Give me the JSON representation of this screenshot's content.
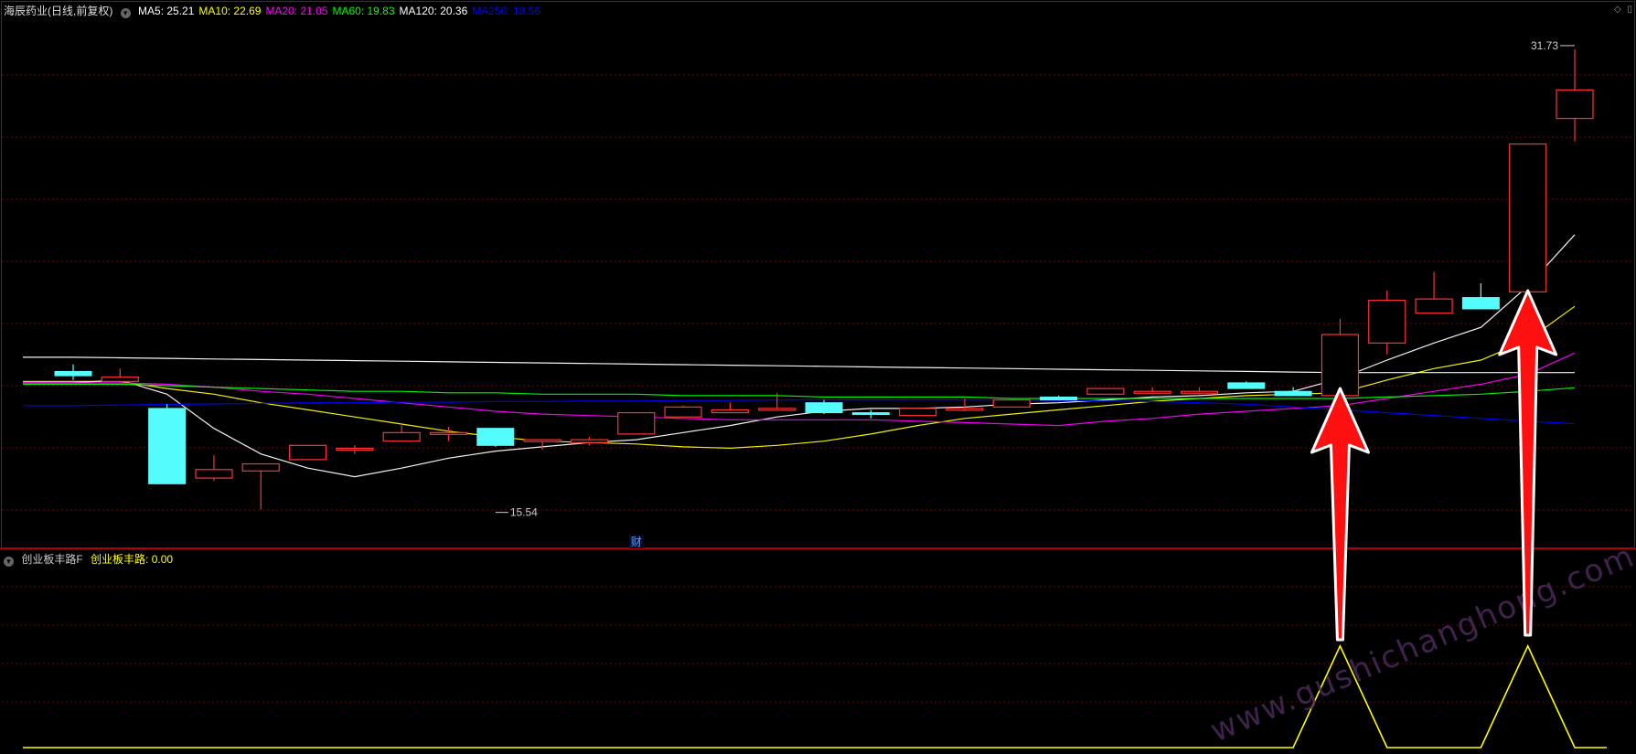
{
  "header": {
    "stock_title": "海辰药业(日线,前复权)",
    "ma_items": [
      {
        "label": "MA5: 25.21",
        "color": "#ffffff"
      },
      {
        "label": "MA10: 22.69",
        "color": "#ffff00"
      },
      {
        "label": "MA20: 21.05",
        "color": "#ff00ff"
      },
      {
        "label": "MA60: 19.83",
        "color": "#00ff00"
      },
      {
        "label": "MA120: 20.36",
        "color": "#ffffff"
      },
      {
        "label": "MA250: 18.56",
        "color": "#0000ff"
      }
    ]
  },
  "indicator": {
    "name": "创业板丰路F",
    "value_label": "创业板丰路: 0.00",
    "value_color": "#ffff00"
  },
  "badge": "财",
  "watermark": "www.gushichanghong.com",
  "chart_data": [
    {
      "type": "candlestick",
      "title": "海辰药业(日线,前复权)",
      "ylim": [
        14.5,
        32.5
      ],
      "annotations": [
        {
          "text": "15.54",
          "x": 9,
          "y": 15.54
        },
        {
          "text": "31.73",
          "x": 32,
          "y": 31.73
        }
      ],
      "up_color": "#ff3232",
      "down_color": "#54fcfc",
      "candles": [
        {
          "o": 20.4,
          "h": 20.65,
          "c": 20.25,
          "l": 20.1
        },
        {
          "o": 20.05,
          "h": 20.5,
          "c": 20.2,
          "l": 20.0
        },
        {
          "o": 19.1,
          "h": 19.25,
          "c": 16.45,
          "l": 16.45
        },
        {
          "o": 16.65,
          "h": 17.45,
          "c": 16.95,
          "l": 16.55
        },
        {
          "o": 16.9,
          "h": 17.0,
          "c": 17.15,
          "l": 15.54
        },
        {
          "o": 17.3,
          "h": 17.75,
          "c": 17.8,
          "l": 17.3
        },
        {
          "o": 17.65,
          "h": 17.8,
          "c": 17.7,
          "l": 17.5
        },
        {
          "o": 17.95,
          "h": 18.5,
          "c": 18.25,
          "l": 17.95
        },
        {
          "o": 18.2,
          "h": 18.45,
          "c": 18.25,
          "l": 17.95
        },
        {
          "o": 18.4,
          "h": 18.4,
          "c": 17.8,
          "l": 17.75
        },
        {
          "o": 17.95,
          "h": 18.0,
          "c": 18.0,
          "l": 17.65
        },
        {
          "o": 17.9,
          "h": 18.1,
          "c": 18.0,
          "l": 17.8
        },
        {
          "o": 18.2,
          "h": 18.9,
          "c": 18.95,
          "l": 18.2
        },
        {
          "o": 18.8,
          "h": 19.2,
          "c": 19.15,
          "l": 18.8
        },
        {
          "o": 18.95,
          "h": 19.3,
          "c": 19.05,
          "l": 18.95
        },
        {
          "o": 19.1,
          "h": 19.65,
          "c": 19.1,
          "l": 19.1
        },
        {
          "o": 19.3,
          "h": 19.4,
          "c": 18.95,
          "l": 18.9
        },
        {
          "o": 18.95,
          "h": 19.05,
          "c": 18.9,
          "l": 18.75
        },
        {
          "o": 18.85,
          "h": 18.95,
          "c": 19.1,
          "l": 18.85
        },
        {
          "o": 19.1,
          "h": 19.45,
          "c": 19.1,
          "l": 19.0
        },
        {
          "o": 19.15,
          "h": 19.4,
          "c": 19.4,
          "l": 19.15
        },
        {
          "o": 19.5,
          "h": 19.55,
          "c": 19.4,
          "l": 19.4
        },
        {
          "o": 19.6,
          "h": 19.7,
          "c": 19.8,
          "l": 19.6
        },
        {
          "o": 19.7,
          "h": 19.85,
          "c": 19.7,
          "l": 19.6
        },
        {
          "o": 19.7,
          "h": 19.85,
          "c": 19.7,
          "l": 19.6
        },
        {
          "o": 20.0,
          "h": 20.05,
          "c": 19.8,
          "l": 19.8
        },
        {
          "o": 19.7,
          "h": 19.85,
          "c": 19.55,
          "l": 19.55
        },
        {
          "o": 19.55,
          "h": 22.25,
          "c": 21.7,
          "l": 19.55
        },
        {
          "o": 21.4,
          "h": 23.25,
          "c": 22.9,
          "l": 21.0
        },
        {
          "o": 22.45,
          "h": 23.9,
          "c": 22.95,
          "l": 22.45
        },
        {
          "o": 23.0,
          "h": 23.5,
          "c": 22.6,
          "l": 22.6
        },
        {
          "o": 23.2,
          "h": 28.4,
          "c": 28.4,
          "l": 23.2
        },
        {
          "o": 29.3,
          "h": 31.73,
          "c": 30.3,
          "l": 28.5
        }
      ],
      "ma_lines": [
        {
          "name": "MA5",
          "color": "#ffffff",
          "values": [
            20.0,
            20.1,
            19.6,
            18.4,
            17.5,
            17.0,
            16.7,
            17.0,
            17.35,
            17.6,
            17.75,
            17.9,
            18.0,
            18.25,
            18.5,
            18.8,
            19.0,
            19.1,
            19.1,
            19.15,
            19.25,
            19.3,
            19.4,
            19.5,
            19.55,
            19.65,
            19.7,
            20.15,
            20.8,
            21.4,
            21.95,
            23.4,
            25.21
          ]
        },
        {
          "name": "MA10",
          "color": "#ffff00",
          "values": [
            20.05,
            20.05,
            19.8,
            19.6,
            19.3,
            19.05,
            18.8,
            18.55,
            18.3,
            18.1,
            17.95,
            17.9,
            17.85,
            17.75,
            17.7,
            17.8,
            17.95,
            18.2,
            18.5,
            18.75,
            18.9,
            19.05,
            19.2,
            19.35,
            19.45,
            19.55,
            19.6,
            19.65,
            20.1,
            20.5,
            20.8,
            21.5,
            22.69
          ]
        },
        {
          "name": "MA20",
          "color": "#ff00ff",
          "values": [
            20.0,
            20.0,
            19.95,
            19.85,
            19.7,
            19.6,
            19.45,
            19.3,
            19.15,
            19.0,
            18.9,
            18.85,
            18.8,
            18.75,
            18.7,
            18.7,
            18.7,
            18.7,
            18.65,
            18.6,
            18.55,
            18.5,
            18.65,
            18.75,
            18.9,
            19.0,
            19.1,
            19.2,
            19.45,
            19.7,
            19.95,
            20.3,
            21.05
          ]
        },
        {
          "name": "MA60",
          "color": "#00ff00",
          "values": [
            19.95,
            19.95,
            19.9,
            19.85,
            19.8,
            19.75,
            19.7,
            19.7,
            19.65,
            19.65,
            19.6,
            19.6,
            19.6,
            19.55,
            19.55,
            19.55,
            19.5,
            19.5,
            19.5,
            19.5,
            19.45,
            19.45,
            19.45,
            19.45,
            19.45,
            19.45,
            19.45,
            19.45,
            19.5,
            19.55,
            19.6,
            19.7,
            19.83
          ]
        },
        {
          "name": "MA120",
          "color": "#ffffff",
          "values": [
            20.9,
            20.88,
            20.86,
            20.84,
            20.82,
            20.8,
            20.78,
            20.76,
            20.74,
            20.72,
            20.7,
            20.68,
            20.66,
            20.64,
            20.62,
            20.6,
            20.58,
            20.56,
            20.54,
            20.52,
            20.5,
            20.48,
            20.46,
            20.44,
            20.42,
            20.4,
            20.38,
            20.36,
            20.36,
            20.36,
            20.36,
            20.36,
            20.36
          ]
        },
        {
          "name": "MA250",
          "color": "#0000ff",
          "values": [
            19.2,
            19.22,
            19.24,
            19.26,
            19.28,
            19.3,
            19.3,
            19.32,
            19.32,
            19.34,
            19.34,
            19.36,
            19.36,
            19.38,
            19.38,
            19.4,
            19.4,
            19.4,
            19.4,
            19.4,
            19.4,
            19.38,
            19.36,
            19.34,
            19.3,
            19.25,
            19.15,
            19.05,
            18.95,
            18.85,
            18.75,
            18.65,
            18.56
          ]
        }
      ]
    },
    {
      "type": "line",
      "title": "创业板丰路F",
      "ylim": [
        0,
        1.6
      ],
      "series": [
        {
          "name": "创业板丰路",
          "color": "#ffff00",
          "values": [
            0,
            0,
            0,
            0,
            0,
            0,
            0,
            0,
            0,
            0,
            0,
            0,
            0,
            0,
            0,
            0,
            0,
            0,
            0,
            0,
            0,
            0,
            0,
            0,
            0,
            0,
            0,
            1,
            0,
            0,
            0,
            1,
            0
          ]
        }
      ]
    }
  ]
}
